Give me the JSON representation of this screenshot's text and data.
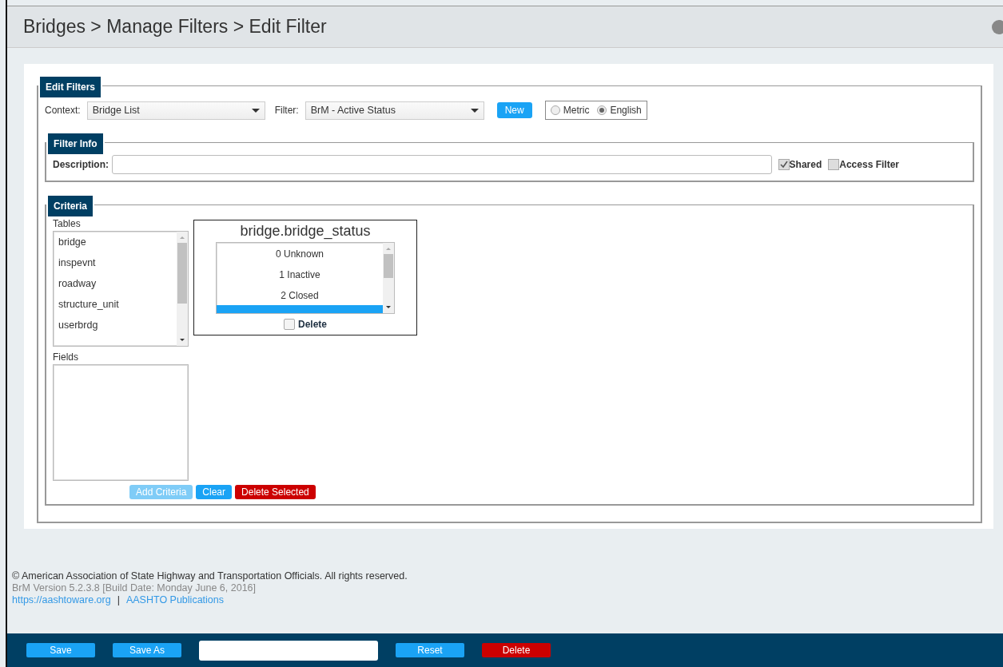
{
  "header": {
    "breadcrumb": "Bridges > Manage Filters > Edit Filter"
  },
  "edit_filters": {
    "legend": "Edit Filters",
    "context_label": "Context:",
    "context_value": "Bridge List",
    "filter_label": "Filter:",
    "filter_value": "BrM - Active Status",
    "new_button": "New",
    "units": [
      {
        "label": "Metric",
        "selected": false
      },
      {
        "label": "English",
        "selected": true
      }
    ]
  },
  "filter_info": {
    "legend": "Filter Info",
    "description_label": "Description:",
    "options": [
      {
        "label": "Shared",
        "checked": true
      },
      {
        "label": "Access Filter",
        "checked": false
      }
    ]
  },
  "criteria": {
    "legend": "Criteria",
    "tables_label": "Tables",
    "tables": [
      {
        "label": "bridge"
      },
      {
        "label": "inspevnt"
      },
      {
        "label": "roadway"
      },
      {
        "label": "structure_unit"
      },
      {
        "label": "userbrdg"
      }
    ],
    "fields_label": "Fields",
    "criterion": {
      "title": "bridge.bridge_status",
      "values": [
        {
          "label": "0 Unknown",
          "selected": false
        },
        {
          "label": "1 Inactive",
          "selected": false
        },
        {
          "label": "2 Closed",
          "selected": false
        },
        {
          "selected": true
        }
      ],
      "delete_label": "Delete",
      "delete_checked": false
    },
    "buttons": [
      {
        "label": "Add Criteria",
        "kind": "disabled"
      },
      {
        "label": "Clear",
        "kind": "primary"
      },
      {
        "label": "Delete Selected",
        "kind": "danger"
      }
    ]
  },
  "footer": {
    "copyright": "© American Association of State Highway and Transportation Officials. All rights reserved.",
    "version": "BrM Version 5.2.3.8 [Build Date: Monday June 6, 2016]",
    "links": [
      "https://aashtoware.org",
      "AASHTO Publications"
    ],
    "separator": "|"
  },
  "bottom_bar": [
    {
      "kind": "button",
      "label": "Save"
    },
    {
      "kind": "button",
      "label": "Save As"
    },
    {
      "kind": "field"
    },
    {
      "kind": "button",
      "label": "Reset"
    },
    {
      "kind": "danger",
      "label": "Delete"
    }
  ]
}
